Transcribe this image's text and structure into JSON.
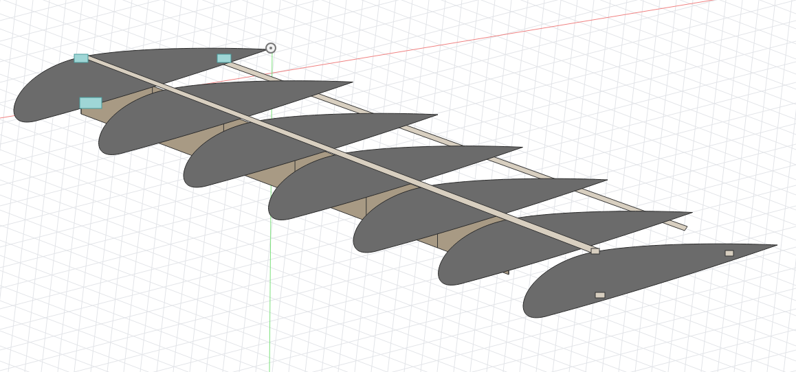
{
  "viewport": {
    "kind": "wing-model"
  }
}
